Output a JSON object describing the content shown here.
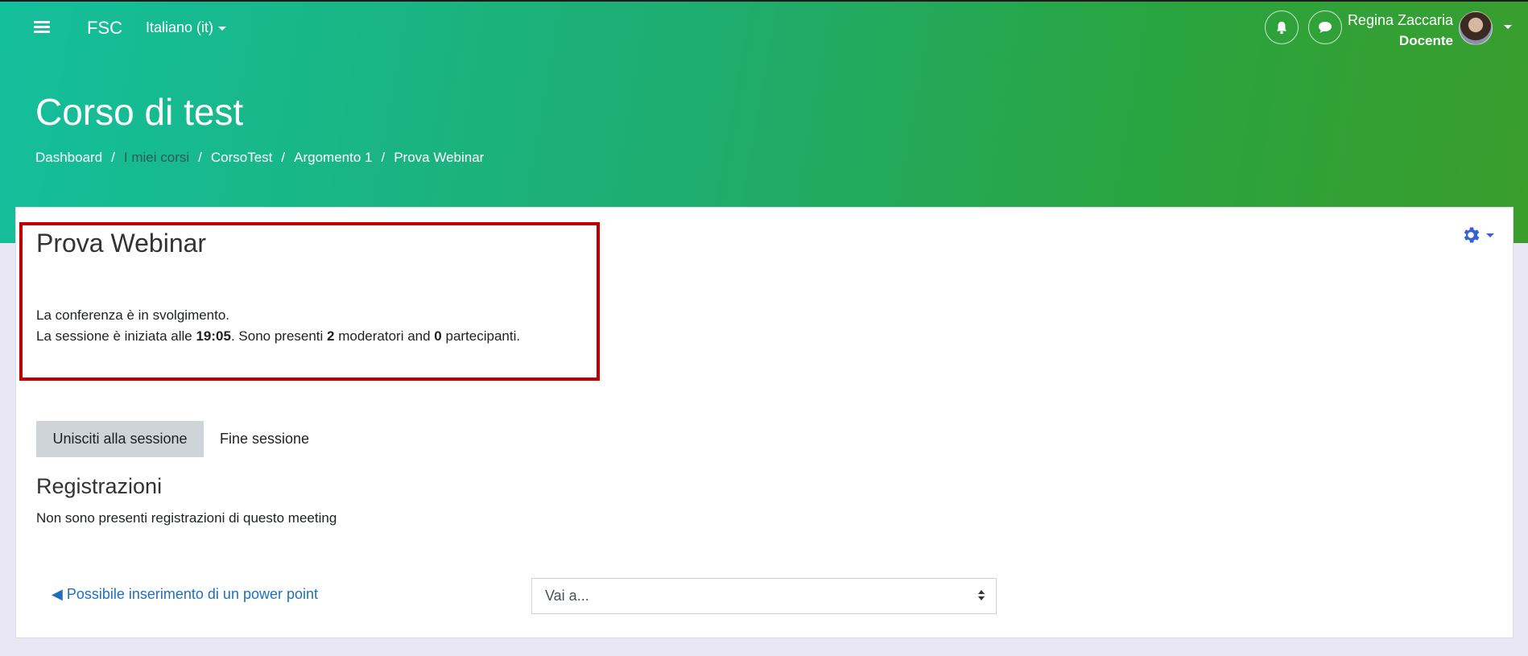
{
  "navbar": {
    "brand": "FSC",
    "language": "Italiano (it)",
    "user_name": "Regina Zaccaria",
    "user_role": "Docente"
  },
  "header": {
    "title": "Corso di test",
    "breadcrumb": [
      "Dashboard",
      "I miei corsi",
      "CorsoTest",
      "Argomento 1",
      "Prova Webinar"
    ],
    "separator": "/"
  },
  "activity": {
    "title": "Prova Webinar",
    "status": "La conferenza è in svolgimento.",
    "session_prefix": "La sessione è iniziata alle ",
    "start_time": "19:05",
    "present_text": ". Sono presenti ",
    "moderators_count": "2",
    "moderators_text": " moderatori and ",
    "participants_count": "0",
    "participants_text": " partecipanti."
  },
  "actions": {
    "join_label": "Unisciti alla sessione",
    "end_label": "Fine sessione"
  },
  "recordings": {
    "title": "Registrazioni",
    "empty_text": "Non sono presenti registrazioni di questo meeting"
  },
  "navigation": {
    "prev_link": "◀ Possibile inserimento di un power point",
    "jump_placeholder": "Vai a..."
  },
  "colors": {
    "accent_link": "#1f6fc0",
    "highlight_border": "#c00000",
    "gear": "#3561d3"
  }
}
